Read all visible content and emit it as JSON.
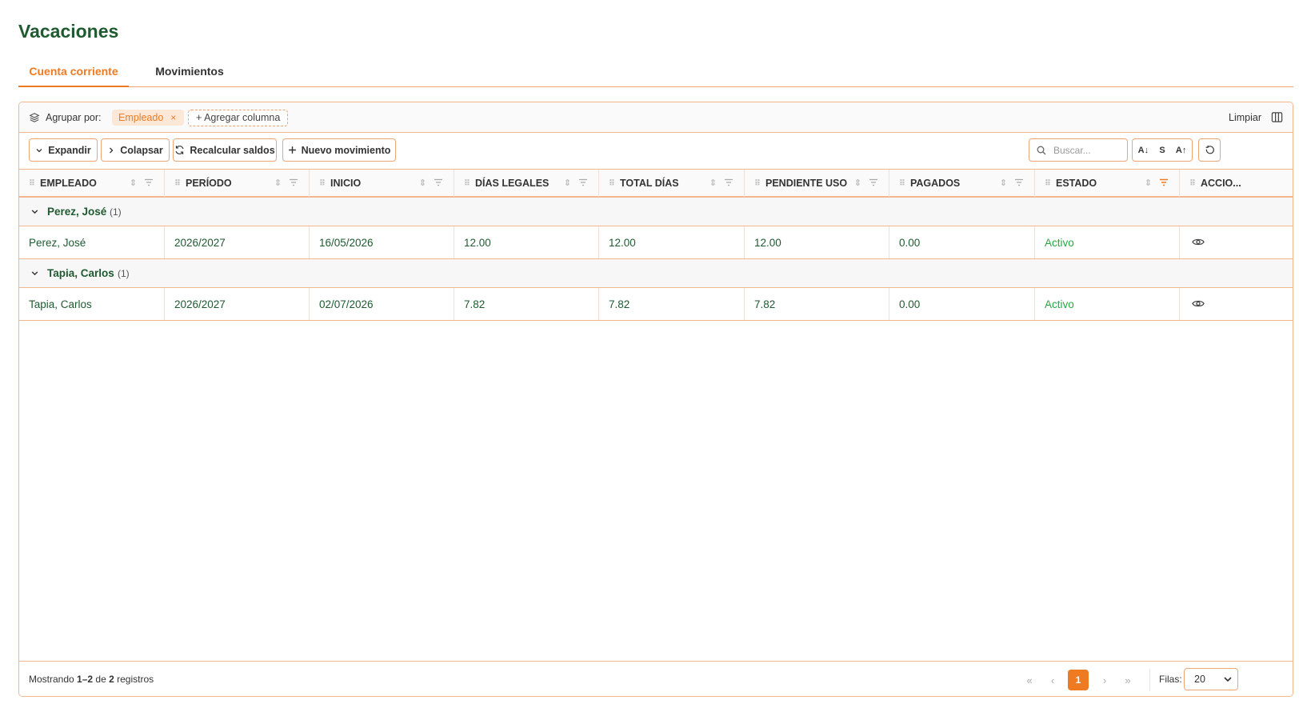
{
  "title": "Vacaciones",
  "tabs": [
    {
      "label": "Cuenta corriente",
      "active": true
    },
    {
      "label": "Movimientos",
      "active": false
    }
  ],
  "groupbar": {
    "label": "Agrupar por:",
    "chip": "Empleado",
    "chip_remove": "×",
    "add_column": "+ Agregar columna",
    "clear": "Limpiar"
  },
  "toolbar": {
    "expand": "Expandir",
    "collapse": "Colapsar",
    "recalc": "Recalcular saldos",
    "new": "Nuevo movimiento",
    "search_placeholder": "Buscar...",
    "font_small": "A↓",
    "font_mid": "S",
    "font_large": "A↑"
  },
  "columns": [
    "EMPLEADO",
    "PERÍODO",
    "INICIO",
    "DÍAS LEGALES",
    "TOTAL DÍAS",
    "PENDIENTE USO",
    "PAGADOS",
    "ESTADO",
    "ACCIO..."
  ],
  "groups": [
    {
      "name": "Perez, José",
      "count": "(1)",
      "rows": [
        {
          "empleado": "Perez, José",
          "periodo": "2026/2027",
          "inicio": "16/05/2026",
          "dias_legales": "12.00",
          "total_dias": "12.00",
          "pendiente_uso": "12.00",
          "pagados": "0.00",
          "estado": "Activo"
        }
      ]
    },
    {
      "name": "Tapia, Carlos",
      "count": "(1)",
      "rows": [
        {
          "empleado": "Tapia, Carlos",
          "periodo": "2026/2027",
          "inicio": "02/07/2026",
          "dias_legales": "7.82",
          "total_dias": "7.82",
          "pendiente_uso": "7.82",
          "pagados": "0.00",
          "estado": "Activo"
        }
      ]
    }
  ],
  "footer": {
    "showing_prefix": "Mostrando ",
    "showing_range": "1–2",
    "showing_mid": " de ",
    "showing_total": "2",
    "showing_suffix": " registros",
    "current_page": "1",
    "rows_label": "Filas:",
    "rows_value": "20"
  },
  "colors": {
    "accent": "#ee7a22",
    "brand_green": "#1f5a30",
    "status_active": "#27a844"
  }
}
